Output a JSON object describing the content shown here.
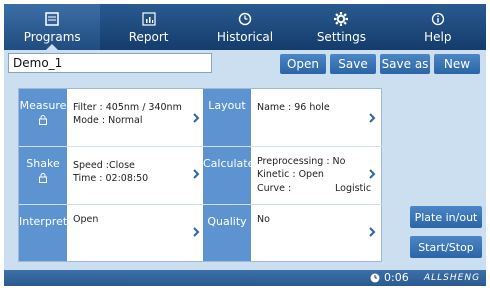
{
  "tabs": [
    {
      "label": "Programs",
      "icon": "programs-icon",
      "active": true
    },
    {
      "label": "Report",
      "icon": "report-icon",
      "active": false
    },
    {
      "label": "Historical",
      "icon": "clock-icon",
      "active": false
    },
    {
      "label": "Settings",
      "icon": "gear-icon",
      "active": false
    },
    {
      "label": "Help",
      "icon": "info-icon",
      "active": false
    }
  ],
  "toolbar": {
    "program_name": "Demo_1",
    "open_label": "Open",
    "save_label": "Save",
    "save_as_label": "Save as",
    "new_label": "New"
  },
  "settings": {
    "measure": {
      "label": "Measure",
      "filter": "Filter : 405nm / 340nm",
      "mode": "Mode : Normal"
    },
    "layout": {
      "label": "Layout",
      "name": "Name : 96 hole"
    },
    "shake": {
      "label": "Shake",
      "speed": "Speed :Close",
      "time": "Time : 02:08:50"
    },
    "calculate": {
      "label": "Calculate",
      "preprocessing": "Preprocessing : No",
      "kinetic": "Kinetic : Open",
      "curve_label": "Curve :",
      "curve_value": "Logistic"
    },
    "interpret": {
      "label": "Interpret",
      "value": "Open"
    },
    "quality": {
      "label": "Quality",
      "value": "No"
    }
  },
  "side_buttons": {
    "plate_in_out": "Plate in/out",
    "start_stop": "Start/Stop"
  },
  "status": {
    "timer": "0:06",
    "brand": "ALLSHENG"
  },
  "colors": {
    "tab_bar": "#1e4a7e",
    "label_blue": "#5d93d1",
    "button_blue": "#3a75b8",
    "background": "#ccdff1"
  }
}
